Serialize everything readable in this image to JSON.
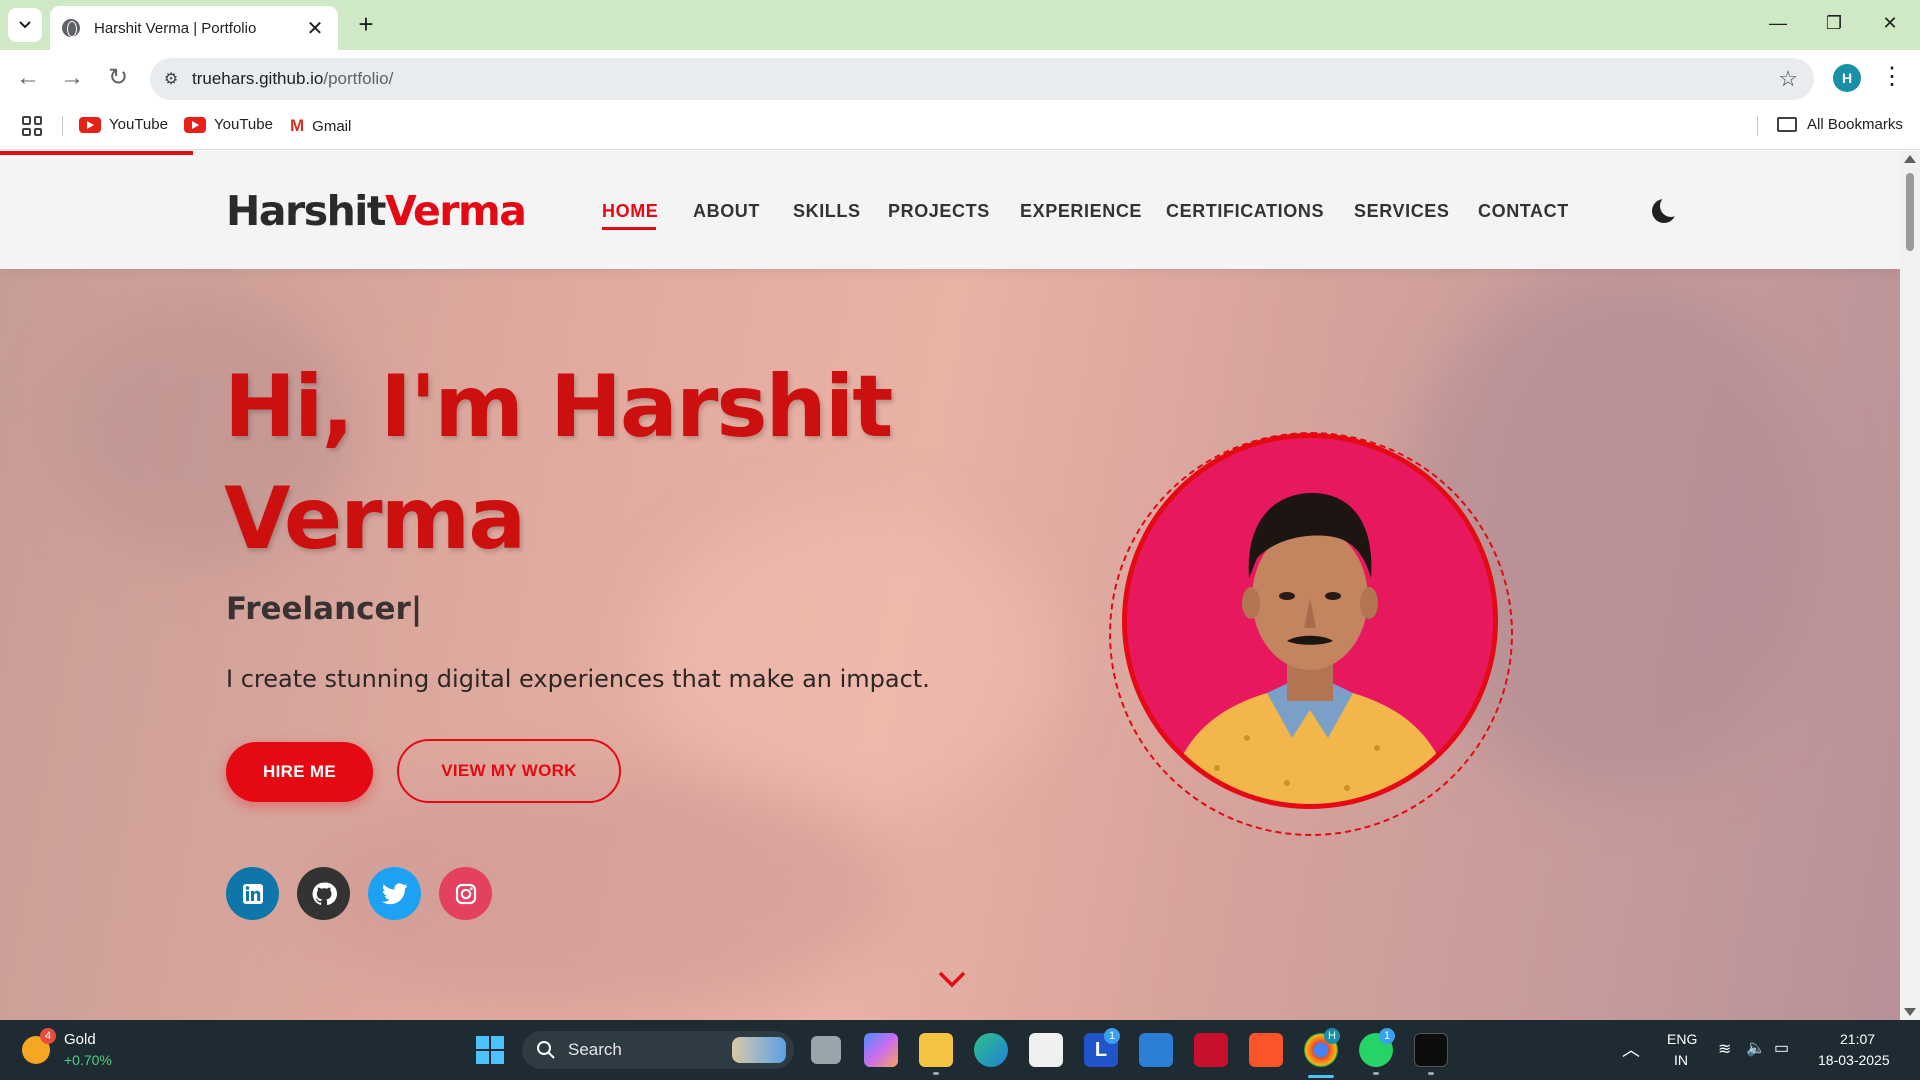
{
  "browser": {
    "tab_title": "Harshit Verma | Portfolio",
    "url_host": "truehars.github.io",
    "url_path": "/portfolio/",
    "profile_initial": "H",
    "bookmarks": [
      {
        "label": "YouTube",
        "icon": "youtube-icon"
      },
      {
        "label": "YouTube",
        "icon": "youtube-icon"
      },
      {
        "label": "Gmail",
        "icon": "gmail-icon"
      }
    ],
    "all_bookmarks_label": "All Bookmarks"
  },
  "site": {
    "logo_first": "Harshit",
    "logo_second": "Verma",
    "nav": [
      {
        "label": "HOME",
        "active": true
      },
      {
        "label": "ABOUT"
      },
      {
        "label": "SKILLS"
      },
      {
        "label": "PROJECTS"
      },
      {
        "label": "EXPERIENCE"
      },
      {
        "label": "CERTIFICATIONS"
      },
      {
        "label": "SERVICES"
      },
      {
        "label": "CONTACT"
      }
    ],
    "accent_color": "#e50914"
  },
  "hero": {
    "title_line1": "Hi, I'm Harshit",
    "title_line2": "Verma",
    "typed_text": "Freelancer|",
    "tagline": "I create stunning digital experiences that make an impact.",
    "hire_button": "HIRE ME",
    "work_button": "VIEW MY WORK",
    "socials": [
      {
        "name": "linkedin",
        "glyph": "in",
        "color": "#0e76a8"
      },
      {
        "name": "github",
        "glyph": "⌥",
        "color": "#333333"
      },
      {
        "name": "twitter",
        "glyph": "🐦",
        "color": "#1da1f2"
      },
      {
        "name": "instagram",
        "glyph": "◎",
        "color": "#e4405f"
      }
    ]
  },
  "taskbar": {
    "widget_badge": "4",
    "widget_title": "Gold",
    "widget_change": "+0.70%",
    "search_label": "Search",
    "lang_top": "ENG",
    "lang_bottom": "IN",
    "time": "21:07",
    "date": "18-03-2025",
    "badges": [
      "1",
      "H",
      "1"
    ]
  }
}
